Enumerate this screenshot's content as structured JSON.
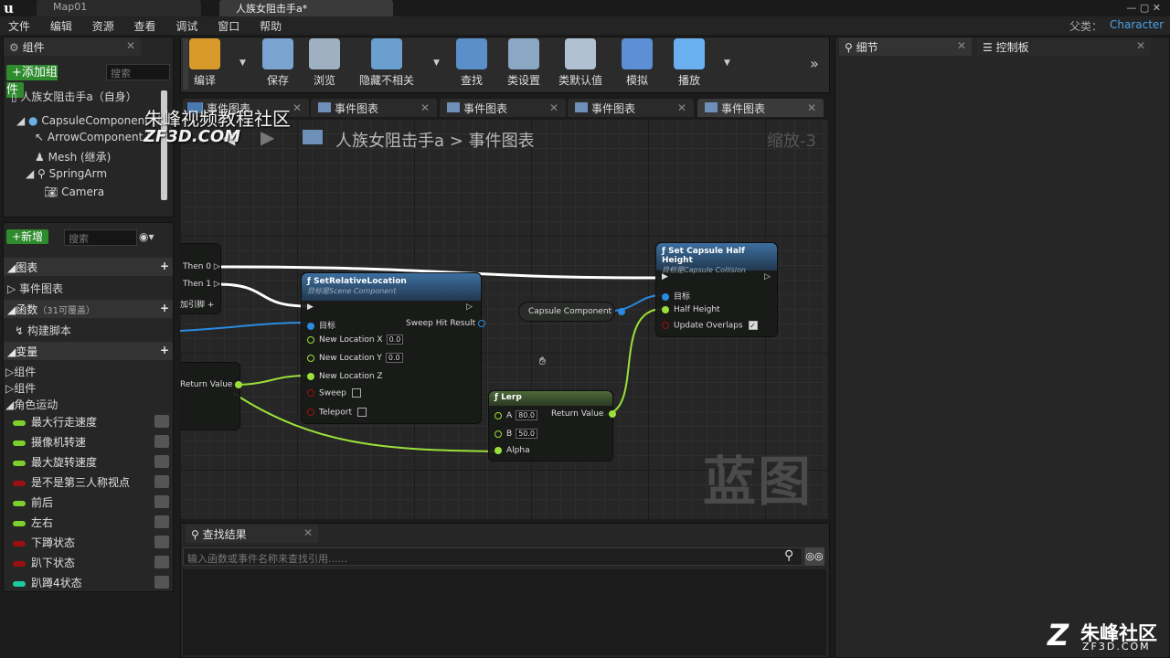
{
  "window": {
    "tabs": [
      "Map01",
      "人族女阻击手a*"
    ],
    "parent_label": "父类：",
    "parent_value": "Character"
  },
  "menu": [
    "文件",
    "编辑",
    "资源",
    "查看",
    "调试",
    "窗口",
    "帮助"
  ],
  "components": {
    "tab": "组件",
    "add_button": "+添加组件",
    "search_placeholder": "搜索",
    "tree": [
      "人族女阻击手a（自身）",
      "CapsuleComponent (继",
      "ArrowComponent (",
      "Mesh (继承)",
      "SpringArm",
      "Camera"
    ]
  },
  "mybp": {
    "new_button": "+新增",
    "search_placeholder": "搜索",
    "graphs_header": "图表",
    "graph_item": "事件图表",
    "functions_header": "函数",
    "functions_note": "（31可覆盖）",
    "function_item": "构建脚本",
    "variables_header": "变量",
    "var_groups": [
      "组件",
      "组件",
      "角色运动"
    ],
    "variables": [
      {
        "name": "最大行走速度",
        "color": "#7ccf2c"
      },
      {
        "name": "摄像机转速",
        "color": "#7ccf2c"
      },
      {
        "name": "最大旋转速度",
        "color": "#7ccf2c"
      },
      {
        "name": "是不是第三人称视点",
        "color": "#9a1010"
      },
      {
        "name": "前后",
        "color": "#7ccf2c"
      },
      {
        "name": "左右",
        "color": "#7ccf2c"
      },
      {
        "name": "下蹲状态",
        "color": "#9a1010"
      },
      {
        "name": "趴下状态",
        "color": "#9a1010"
      },
      {
        "name": "趴蹲4状态",
        "color": "#1ec9a0"
      }
    ]
  },
  "toolbar": [
    "编译",
    "保存",
    "浏览",
    "隐藏不相关",
    "查找",
    "类设置",
    "类默认值",
    "模拟",
    "播放"
  ],
  "editor_tabs": [
    "事件图表",
    "事件图表",
    "事件图表",
    "事件图表",
    "事件图表"
  ],
  "breadcrumb": {
    "root": "人族女阻击手a",
    "sep": ">",
    "leaf": "事件图表",
    "zoom": "缩放-3"
  },
  "watermark": {
    "top": "朱峰视频教程社区",
    "url": "ZF3D.COM",
    "graph": "蓝图",
    "corner": "朱峰社区",
    "corner_url": "ZF3D.COM"
  },
  "nodes": {
    "seq": {
      "then0": "Then 0",
      "then1": "Then 1",
      "add": "添加引脚 +"
    },
    "retval": {
      "label": "Return Value"
    },
    "setrel": {
      "title": "SetRelativeLocation",
      "sub": "目标是Scene Component",
      "target": "目标",
      "sweep_hit": "Sweep Hit Result",
      "nlx": "New Location X",
      "nlx_v": "0.0",
      "nly": "New Location Y",
      "nly_v": "0.0",
      "nlz": "New Location Z",
      "sweep": "Sweep",
      "teleport": "Teleport"
    },
    "capsule": {
      "label": "Capsule Component"
    },
    "setcap": {
      "title": "Set Capsule Half Height",
      "sub": "目标是Capsule Collision",
      "target": "目标",
      "half": "Half Height",
      "overlaps": "Update Overlaps"
    },
    "lerp": {
      "title": "Lerp",
      "a": "A",
      "a_v": "80.0",
      "b": "B",
      "b_v": "50.0",
      "alpha": "Alpha",
      "ret": "Return Value"
    }
  },
  "details": {
    "tab1": "细节",
    "tab2": "控制板"
  },
  "find": {
    "tab": "查找结果",
    "placeholder": "输入函数或事件名称来查找引用......"
  }
}
